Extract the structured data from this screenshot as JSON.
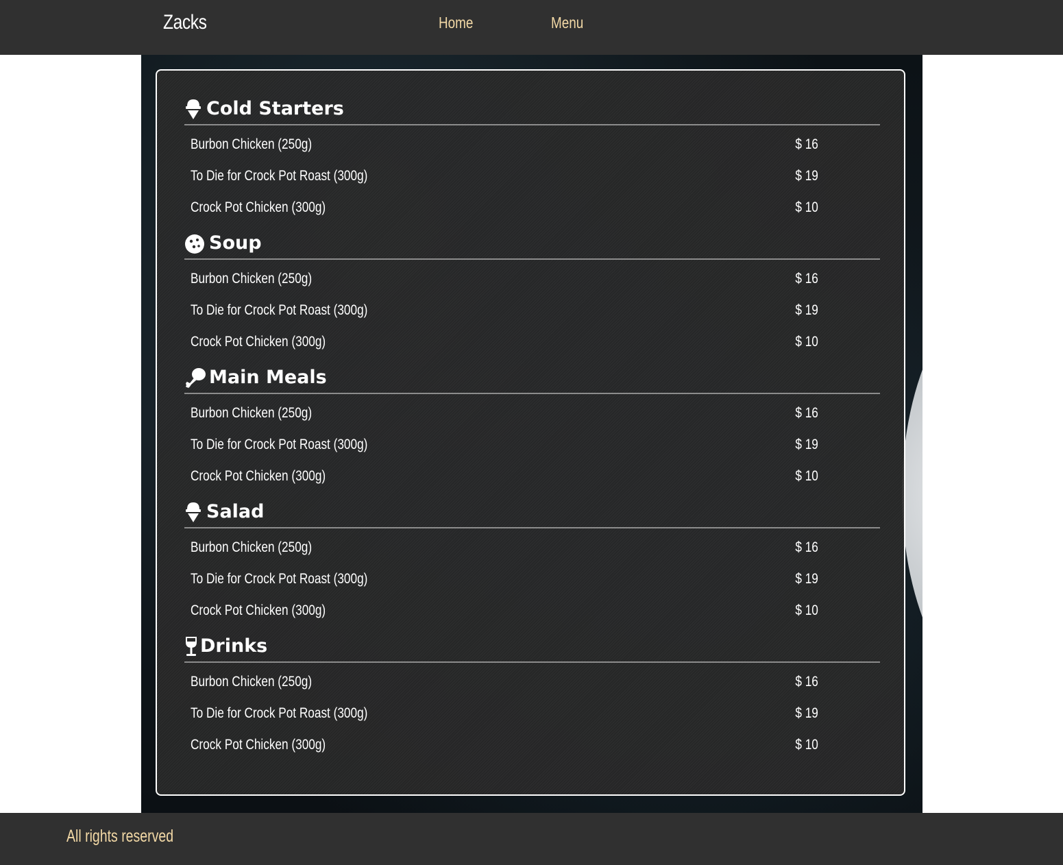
{
  "header": {
    "brand": "Zacks",
    "nav": [
      {
        "label": "Home"
      },
      {
        "label": "Menu"
      }
    ]
  },
  "menu": {
    "sections": [
      {
        "title": "Cold Starters",
        "icon": "ice-cream-icon",
        "items": [
          {
            "name": "Burbon Chicken (250g)",
            "price": "$ 16"
          },
          {
            "name": "To Die for Crock Pot Roast (300g)",
            "price": "$ 19"
          },
          {
            "name": "Crock Pot Chicken (300g)",
            "price": "$ 10"
          }
        ]
      },
      {
        "title": "Soup",
        "icon": "cookie-icon",
        "items": [
          {
            "name": "Burbon Chicken (250g)",
            "price": "$ 16"
          },
          {
            "name": "To Die for Crock Pot Roast (300g)",
            "price": "$ 19"
          },
          {
            "name": "Crock Pot Chicken (300g)",
            "price": "$ 10"
          }
        ]
      },
      {
        "title": "Main Meals",
        "icon": "drumstick-icon",
        "items": [
          {
            "name": "Burbon Chicken (250g)",
            "price": "$ 16"
          },
          {
            "name": "To Die for Crock Pot Roast (300g)",
            "price": "$ 19"
          },
          {
            "name": "Crock Pot Chicken (300g)",
            "price": "$ 10"
          }
        ]
      },
      {
        "title": "Salad",
        "icon": "ice-cream-icon",
        "items": [
          {
            "name": "Burbon Chicken (250g)",
            "price": "$ 16"
          },
          {
            "name": "To Die for Crock Pot Roast (300g)",
            "price": "$ 19"
          },
          {
            "name": "Crock Pot Chicken (300g)",
            "price": "$ 10"
          }
        ]
      },
      {
        "title": "Drinks",
        "icon": "wine-glass-icon",
        "items": [
          {
            "name": "Burbon Chicken (250g)",
            "price": "$ 16"
          },
          {
            "name": "To Die for Crock Pot Roast (300g)",
            "price": "$ 19"
          },
          {
            "name": "Crock Pot Chicken (300g)",
            "price": "$ 10"
          }
        ]
      }
    ]
  },
  "footer": {
    "text": "All rights reserved"
  },
  "colors": {
    "bar": "#303030",
    "accent": "#f3d9a6",
    "panel_border": "#ffffff"
  }
}
